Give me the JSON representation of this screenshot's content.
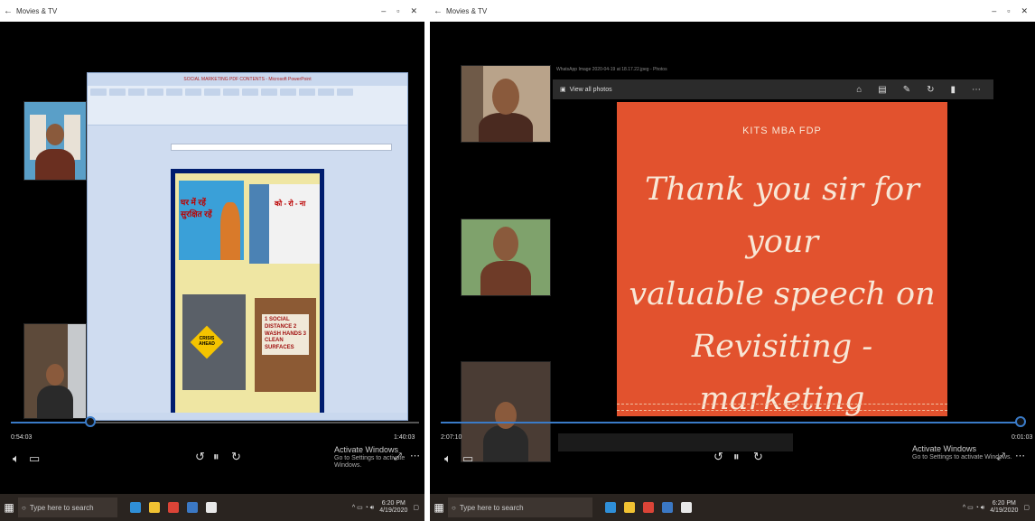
{
  "left": {
    "title": "Movies & TV",
    "ppt_title": "SOCIAL MARKETING PDF CONTENTS - Microsoft PowerPoint",
    "time_elapsed": "0:54:03",
    "time_remaining": "1:40:03",
    "activate_title": "Activate Windows",
    "activate_sub": "Go to Settings to activate Windows.",
    "taskbar_search": "Type here to search",
    "clock_time": "6:20 PM",
    "clock_date": "4/19/2020",
    "slide_pics": [
      {
        "text": "घर में रहें सुरक्षित रहें"
      },
      {
        "text": "को - रो - ना"
      },
      {
        "text": "CRISIS AHEAD"
      },
      {
        "text": "1 SOCIAL DISTANCE 2 WASH HANDS 3 CLEAN SURFACES"
      }
    ]
  },
  "right": {
    "title": "Movies & TV",
    "photo_title": "WhatsApp Image 2020-04-19 at 18.17.22.jpeg - Photos",
    "view_all": "View all photos",
    "slide_header": "KITS MBA FDP",
    "slide_lines": [
      "Thank you sir for your",
      "valuable speech on",
      "Revisiting - marketing"
    ],
    "time_elapsed": "2:07:10",
    "time_remaining": "0:01:03",
    "activate_title": "Activate Windows",
    "activate_sub": "Go to Settings to activate Windows.",
    "taskbar_search": "Type here to search",
    "clock_time": "6:20 PM",
    "clock_date": "4/19/2020"
  },
  "colors": {
    "slide_orange": "#e2522e",
    "timeline_blue": "#3a7bc8",
    "ppt_frame": "#001d6e",
    "slide_yellow": "#efe6a3"
  }
}
